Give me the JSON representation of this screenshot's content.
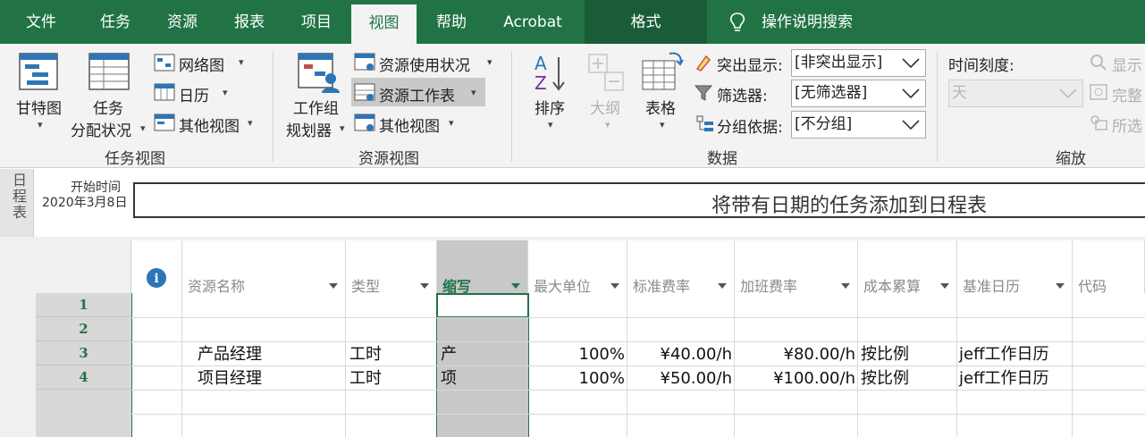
{
  "tabs": [
    "文件",
    "任务",
    "资源",
    "报表",
    "项目",
    "视图",
    "帮助",
    "Acrobat",
    "格式"
  ],
  "active_tab": "视图",
  "search_label": "操作说明搜索",
  "ribbon": {
    "task_views": {
      "gantt": "甘特图",
      "task_usage_l1": "任务",
      "task_usage_l2": "分配状况",
      "network": "网络图",
      "calendar": "日历",
      "other_views": "其他视图",
      "group_label": "任务视图"
    },
    "resource_views": {
      "team_planner_l1": "工作组",
      "team_planner_l2": "规划器",
      "resource_usage": "资源使用状况",
      "resource_sheet": "资源工作表",
      "other_views": "其他视图",
      "group_label": "资源视图"
    },
    "data": {
      "sort": "排序",
      "outline": "大纲",
      "tables": "表格",
      "highlight_label": "突出显示:",
      "highlight_value": "[非突出显示]",
      "filter_label": "筛选器:",
      "filter_value": "[无筛选器]",
      "group_label_text": "分组依据:",
      "group_value": "[不分组]",
      "group_label": "数据"
    },
    "zoom": {
      "timescale_label": "时间刻度:",
      "timescale_value": "天",
      "show": "显示",
      "complete": "完整",
      "selected": "所选",
      "group_label": "缩放"
    }
  },
  "timeline": {
    "side_label": "日程表",
    "start_label": "开始时间",
    "start_date": "2020年3月8日",
    "placeholder": "将带有日期的任务添加到日程表"
  },
  "sheet": {
    "info_icon": "i",
    "columns": [
      "资源名称",
      "类型",
      "缩写",
      "最大单位",
      "标准费率",
      "加班费率",
      "成本累算",
      "基准日历",
      "代码"
    ],
    "rows": [
      {
        "num": "1",
        "name": "",
        "type": "",
        "initials": "",
        "max": "",
        "std": "",
        "ovt": "",
        "accrue": "",
        "cal": ""
      },
      {
        "num": "2",
        "name": "",
        "type": "",
        "initials": "",
        "max": "",
        "std": "",
        "ovt": "",
        "accrue": "",
        "cal": ""
      },
      {
        "num": "3",
        "name": "产品经理",
        "type": "工时",
        "initials": "产",
        "max": "100%",
        "std": "¥40.00/h",
        "ovt": "¥80.00/h",
        "accrue": "按比例",
        "cal": "jeff工作日历"
      },
      {
        "num": "4",
        "name": "项目经理",
        "type": "工时",
        "initials": "项",
        "max": "100%",
        "std": "¥50.00/h",
        "ovt": "¥100.00/h",
        "accrue": "按比例",
        "cal": "jeff工作日历"
      }
    ]
  },
  "colors": {
    "accent": "#217346",
    "format_tab": "#1a5c38",
    "selected_col": "#c8c8c8"
  }
}
